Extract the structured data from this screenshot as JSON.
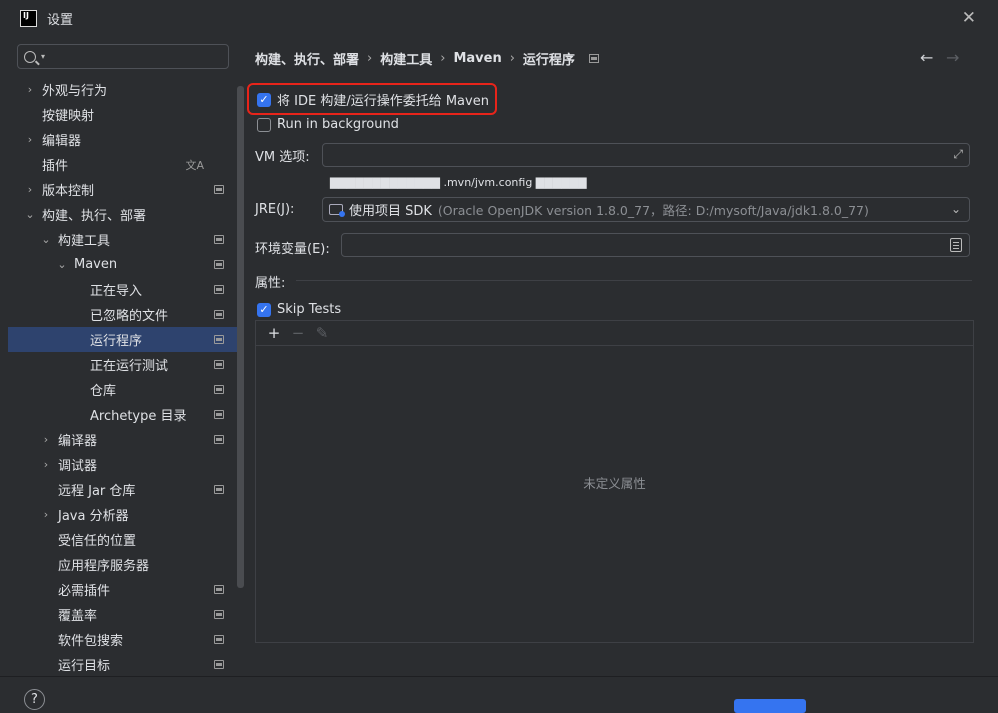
{
  "window": {
    "title": "设置",
    "logo_text": "IJ",
    "close_glyph": "✕"
  },
  "search": {
    "value": "",
    "placeholder": ""
  },
  "tree": [
    {
      "label": "外观与行为",
      "level": 0,
      "chevron": "›",
      "icon": ""
    },
    {
      "label": "按键映射",
      "level": 0,
      "chevron": "",
      "icon": ""
    },
    {
      "label": "编辑器",
      "level": 0,
      "chevron": "›",
      "icon": ""
    },
    {
      "label": "插件",
      "level": 0,
      "chevron": "",
      "icon": "translate"
    },
    {
      "label": "版本控制",
      "level": 0,
      "chevron": "›",
      "icon": "project"
    },
    {
      "label": "构建、执行、部署",
      "level": 0,
      "chevron": "⌄",
      "icon": ""
    },
    {
      "label": "构建工具",
      "level": 1,
      "chevron": "⌄",
      "icon": "project"
    },
    {
      "label": "Maven",
      "level": 2,
      "chevron": "⌄",
      "icon": "project"
    },
    {
      "label": "正在导入",
      "level": 3,
      "chevron": "",
      "icon": "project"
    },
    {
      "label": "已忽略的文件",
      "level": 3,
      "chevron": "",
      "icon": "project"
    },
    {
      "label": "运行程序",
      "level": 3,
      "chevron": "",
      "icon": "project",
      "selected": true
    },
    {
      "label": "正在运行测试",
      "level": 3,
      "chevron": "",
      "icon": "project"
    },
    {
      "label": "仓库",
      "level": 3,
      "chevron": "",
      "icon": "project"
    },
    {
      "label": "Archetype 目录",
      "level": 3,
      "chevron": "",
      "icon": "project"
    },
    {
      "label": "编译器",
      "level": 1,
      "chevron": "›",
      "icon": "project"
    },
    {
      "label": "调试器",
      "level": 1,
      "chevron": "›",
      "icon": ""
    },
    {
      "label": "远程 Jar 仓库",
      "level": 1,
      "chevron": "",
      "icon": "project"
    },
    {
      "label": "Java 分析器",
      "level": 1,
      "chevron": "›",
      "icon": ""
    },
    {
      "label": "受信任的位置",
      "level": 1,
      "chevron": "",
      "icon": ""
    },
    {
      "label": "应用程序服务器",
      "level": 1,
      "chevron": "",
      "icon": ""
    },
    {
      "label": "必需插件",
      "level": 1,
      "chevron": "",
      "icon": "project"
    },
    {
      "label": "覆盖率",
      "level": 1,
      "chevron": "",
      "icon": "project"
    },
    {
      "label": "软件包搜索",
      "level": 1,
      "chevron": "",
      "icon": "project"
    },
    {
      "label": "运行目标",
      "level": 1,
      "chevron": "",
      "icon": "project"
    }
  ],
  "breadcrumb": {
    "items": [
      "构建、执行、部署",
      "构建工具",
      "Maven",
      "运行程序"
    ],
    "separator": "›"
  },
  "nav": {
    "back": "←",
    "forward": "→"
  },
  "main": {
    "delegate": {
      "label": "将 IDE 构建/运行操作委托给 Maven",
      "checked": true
    },
    "background": {
      "label": "Run in background",
      "checked": false
    },
    "vm_options": {
      "label": "VM 选项:",
      "value": ""
    },
    "vm_hint": "▇▇▇▇▇▇▇▇▇▇▇▇▇ .mvn/jvm.config ▇▇▇▇▇▇",
    "jre": {
      "label": "JRE(J):",
      "primary": "使用项目 SDK",
      "secondary": "(Oracle OpenJDK version 1.8.0_77，路径: D:/mysoft/Java/jdk1.8.0_77)"
    },
    "env": {
      "label": "环境变量(E):",
      "value": ""
    },
    "properties": {
      "title": "属性:",
      "skip_tests": {
        "label": "Skip Tests",
        "checked": true
      },
      "toolbar": {
        "add": "+",
        "remove": "−",
        "edit": "✎"
      },
      "empty_text": "未定义属性"
    }
  },
  "bottom": {
    "help": "?"
  },
  "colors": {
    "accent": "#3574f0",
    "highlight_border": "#e8241a",
    "selected_row": "#2e436e",
    "background": "#2b2d30"
  }
}
